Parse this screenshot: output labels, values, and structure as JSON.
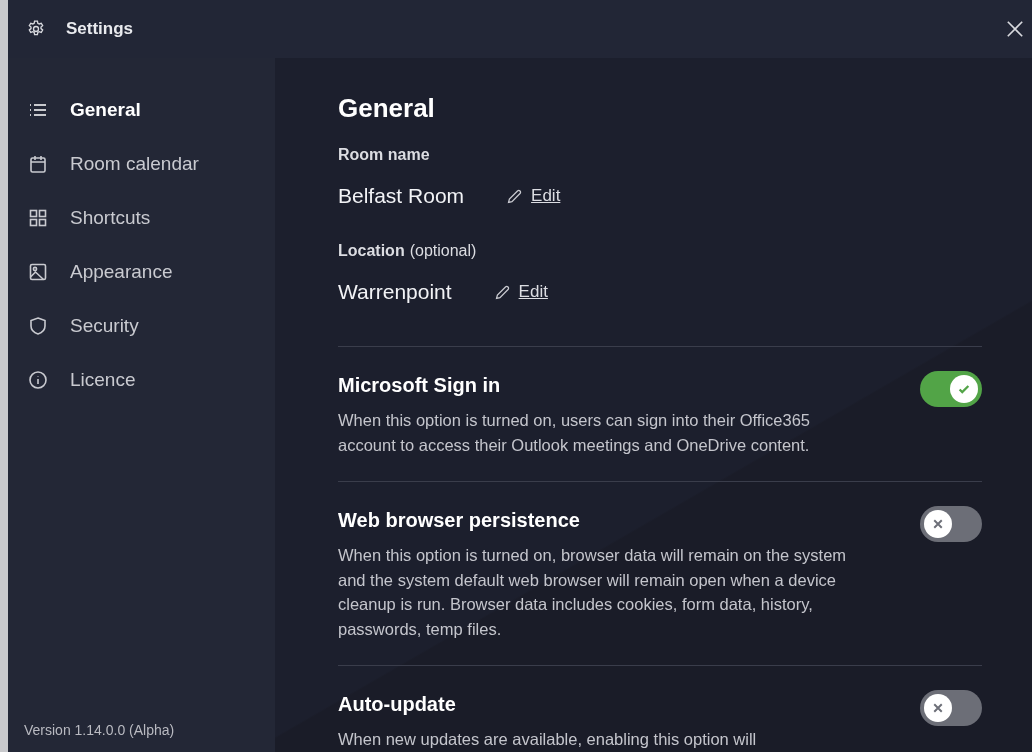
{
  "window": {
    "title": "Settings"
  },
  "sidebar": {
    "items": [
      {
        "label": "General",
        "selected": true
      },
      {
        "label": "Room calendar",
        "selected": false
      },
      {
        "label": "Shortcuts",
        "selected": false
      },
      {
        "label": "Appearance",
        "selected": false
      },
      {
        "label": "Security",
        "selected": false
      },
      {
        "label": "Licence",
        "selected": false
      }
    ],
    "version": "Version 1.14.0.0 (Alpha)"
  },
  "page": {
    "title": "General",
    "fields": [
      {
        "label": "Room name",
        "value": "Belfast Room",
        "action": "Edit"
      },
      {
        "label": "Location",
        "note": "(optional)",
        "value": "Warrenpoint",
        "action": "Edit"
      }
    ],
    "options": [
      {
        "title": "Microsoft Sign in",
        "description": "When this option is turned on, users can sign into their Office365 account to access their Outlook meetings and OneDrive content.",
        "on": true
      },
      {
        "title": "Web browser persistence",
        "description": "When this option is turned on, browser data will remain on the system and the system default web browser will remain open when a device cleanup is run. Browser data includes cookies, form data, history, passwords, temp files.",
        "on": false
      },
      {
        "title": "Auto-update",
        "description": "When new updates are available, enabling this option will",
        "on": false
      }
    ]
  }
}
